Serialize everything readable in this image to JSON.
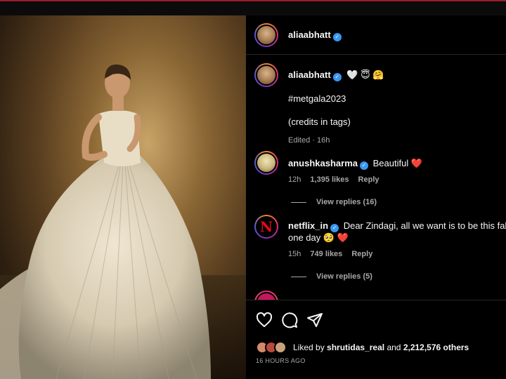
{
  "post": {
    "author": "aliaabhatt",
    "caption_line1_suffix": "🤍 😇 🤗",
    "caption_hashtag": "#metgala2023",
    "caption_credits": "(credits in tags)",
    "caption_meta": "Edited · 16h"
  },
  "comments": [
    {
      "username": "anushkasharma",
      "text": "Beautiful",
      "emoji": "❤️",
      "age": "12h",
      "likes": "1,395 likes",
      "reply_label": "Reply",
      "view_replies": "View replies (16)"
    },
    {
      "username": "netflix_in",
      "text_line1": "Dear Zindagi, all we want is to be this fabu",
      "text_line2": "one day",
      "emoji": "🥺 ❤️",
      "age": "15h",
      "likes": "749 likes",
      "reply_label": "Reply",
      "view_replies": "View replies (5)"
    }
  ],
  "actions": {
    "like_icon": "heart-outline-icon",
    "comment_icon": "speech-bubble-icon",
    "share_icon": "paper-plane-icon"
  },
  "likes": {
    "prefix": "Liked by",
    "user": "shrutidas_real",
    "middle": "and",
    "count": "2,212,576 others"
  },
  "timestamp": "16 HOURS AGO",
  "colors": {
    "verified": "#3897f0",
    "heart": "#ed4956",
    "netflix": "#e50914",
    "muted_text": "#a8a8a8"
  }
}
